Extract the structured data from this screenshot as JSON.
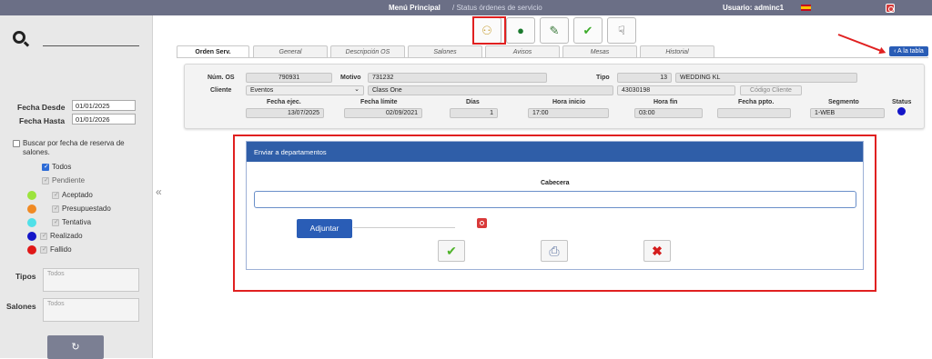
{
  "topbar": {
    "menu": "Menú Principal",
    "crumb": "/ Status órdenes de servicio",
    "user": "Usuario: adminc1"
  },
  "filters": {
    "fecha_desde_label": "Fecha Desde",
    "fecha_desde": "01/01/2025",
    "fecha_hasta_label": "Fecha Hasta",
    "fecha_hasta": "01/01/2026",
    "reserva_label": "Buscar por fecha de reserva de salones.",
    "todos": "Todos",
    "pendiente": "Pendiente",
    "statuses": [
      {
        "label": "Aceptado",
        "color": "#9be33c"
      },
      {
        "label": "Presupuestado",
        "color": "#f08a24"
      },
      {
        "label": "Tentativa",
        "color": "#4fe0e8"
      },
      {
        "label": "Realizado",
        "color": "#1416c8"
      },
      {
        "label": "Fallido",
        "color": "#e01818"
      }
    ],
    "tipos_label": "Tipos",
    "tipos_placeholder": "Todos",
    "salones_label": "Salones",
    "salones_placeholder": "Todos"
  },
  "back_label": "‹ A la tabla",
  "tabs": [
    "Orden Serv.",
    "General",
    "Descripción OS",
    "Salones",
    "Avisos",
    "Mesas",
    "Historial"
  ],
  "order": {
    "num_os_label": "Núm. OS",
    "num_os": "790931",
    "motivo_label": "Motivo",
    "motivo": "731232",
    "tipo_label": "Tipo",
    "tipo_num": "13",
    "tipo_name": "WEDDING KL",
    "cliente_label": "Cliente",
    "cliente": "Eventos",
    "cliente_name": "Class One",
    "cliente_code": "43030198",
    "codigo_ph": "Código Cliente",
    "fecha_ejec_label": "Fecha ejec.",
    "fecha_ejec": "13/07/2025",
    "fecha_limite_label": "Fecha límite",
    "fecha_limite": "02/09/2021",
    "dias_label": "Días",
    "dias": "1",
    "hora_inicio_label": "Hora inicio",
    "hora_inicio": "17:00",
    "hora_fin_label": "Hora fin",
    "hora_fin": "03:00",
    "fecha_ppto_label": "Fecha ppto.",
    "fecha_ppto": "",
    "segmento_label": "Segmento",
    "segmento": "1-WEB",
    "status_label": "Status",
    "status_color": "#1416c8"
  },
  "panel": {
    "title": "Enviar a departamentos",
    "cabecera": "Cabecera",
    "adjuntar": "Adjuntar"
  }
}
